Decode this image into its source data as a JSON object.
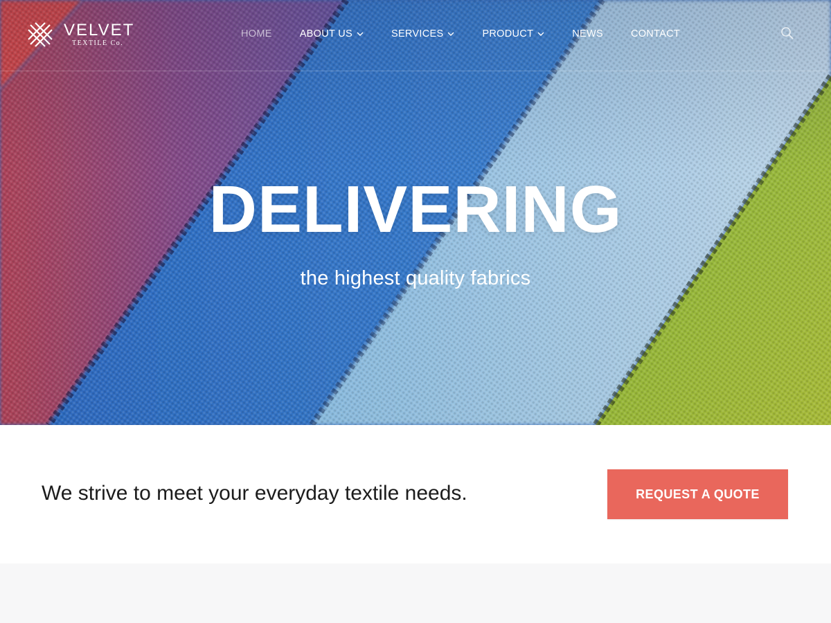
{
  "brand": {
    "name": "VELVET",
    "tagline": "TEXTILE Co."
  },
  "nav": {
    "items": [
      {
        "label": "HOME",
        "active": true,
        "has_dropdown": false
      },
      {
        "label": "ABOUT US",
        "active": false,
        "has_dropdown": true
      },
      {
        "label": "SERVICES",
        "active": false,
        "has_dropdown": true
      },
      {
        "label": "PRODUCT",
        "active": false,
        "has_dropdown": true
      },
      {
        "label": "NEWS",
        "active": false,
        "has_dropdown": false
      },
      {
        "label": "CONTACT",
        "active": false,
        "has_dropdown": false
      }
    ],
    "search_icon": "search-icon"
  },
  "hero": {
    "title": "DELIVERING",
    "subtitle": "the highest quality fabrics"
  },
  "cta": {
    "text": "We strive to meet your everyday textile needs.",
    "button_label": "REQUEST A QUOTE"
  },
  "colors": {
    "accent": "#e9675c",
    "text_dark": "#1c1c1c",
    "white": "#ffffff",
    "lower_band": "#f7f7f8"
  }
}
